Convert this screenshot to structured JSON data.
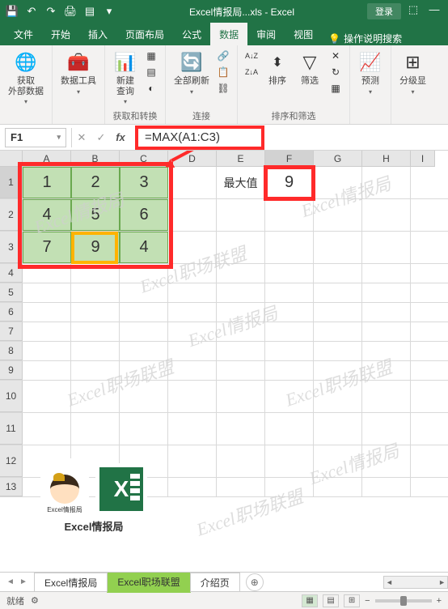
{
  "titlebar": {
    "filename": "Excel情报局...xls - Excel",
    "login": "登录"
  },
  "tabs": {
    "file": "文件",
    "home": "开始",
    "insert": "插入",
    "layout": "页面布局",
    "formula": "公式",
    "data": "数据",
    "review": "审阅",
    "view": "视图",
    "tell_me": "操作说明搜索"
  },
  "ribbon": {
    "get_external": "获取\n外部数据",
    "data_tools": "数据工具",
    "new_query": "新建\n查询",
    "group_get": "获取和转换",
    "refresh_all": "全部刷新",
    "group_conn": "连接",
    "sort": "排序",
    "filter": "筛选",
    "group_sortfilter": "排序和筛选",
    "forecast": "预测",
    "subtotal": "分级显"
  },
  "namebox": "F1",
  "formula": "=MAX(A1:C3)",
  "columns": [
    "A",
    "B",
    "C",
    "D",
    "E",
    "F",
    "G",
    "H",
    "I"
  ],
  "rows": [
    "1",
    "2",
    "3",
    "4",
    "5",
    "6",
    "7",
    "8",
    "9",
    "10",
    "11",
    "12",
    "13"
  ],
  "gridvals": {
    "a1": "1",
    "b1": "2",
    "c1": "3",
    "a2": "4",
    "b2": "5",
    "c2": "6",
    "a3": "7",
    "b3": "9",
    "c3": "4"
  },
  "label_max": "最大值",
  "f1_value": "9",
  "watermark1": "Excel情报局",
  "watermark2": "Excel职场联盟",
  "logo": {
    "girl_label": "Excel情报局",
    "caption": "Excel情报局"
  },
  "sheets": {
    "tab1": "Excel情报局",
    "tab2": "Excel职场联盟",
    "tab3": "介绍页"
  },
  "statusbar": {
    "ready": "就绪",
    "zoom": "+"
  }
}
